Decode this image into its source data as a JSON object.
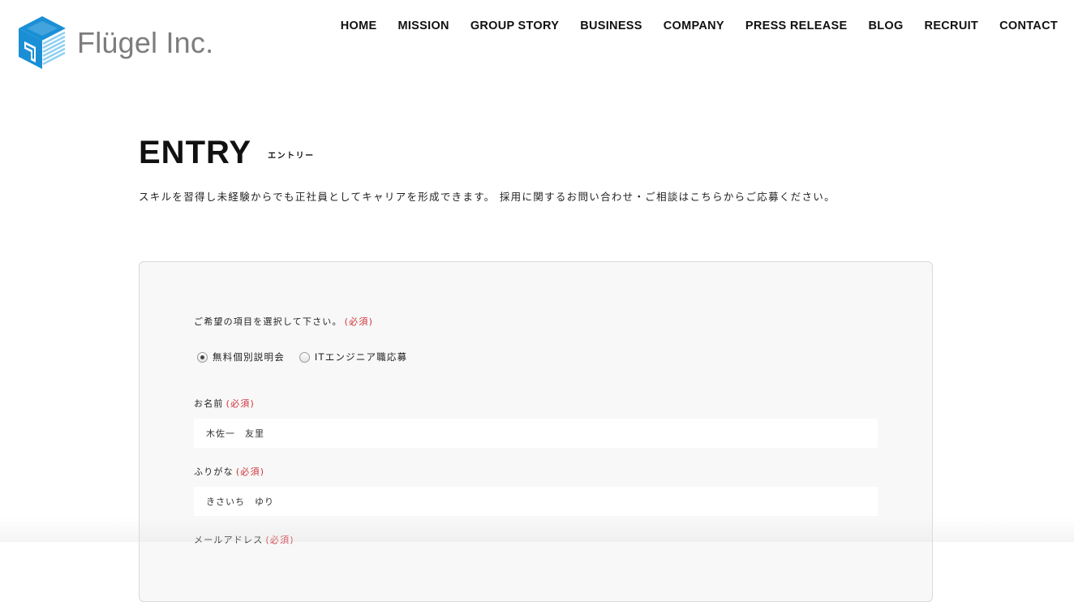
{
  "brand": {
    "name": "Flügel Inc.",
    "logo_icon": "isometric-cube-logo",
    "colors": {
      "primary": "#1a8fd6",
      "light": "#6cc3f0",
      "text": "#7d7d7d"
    }
  },
  "nav": {
    "items": [
      {
        "label": "HOME"
      },
      {
        "label": "MISSION"
      },
      {
        "label": "GROUP STORY"
      },
      {
        "label": "BUSINESS"
      },
      {
        "label": "COMPANY"
      },
      {
        "label": "PRESS RELEASE"
      },
      {
        "label": "BLOG"
      },
      {
        "label": "RECRUIT"
      },
      {
        "label": "CONTACT"
      }
    ]
  },
  "page": {
    "title": "ENTRY",
    "subtitle": "エントリー",
    "intro": "スキルを習得し未経験からでも正社員としてキャリアを形成できます。 採用に関するお問い合わせ・ご相談はこちらからご応募ください。"
  },
  "form": {
    "required_mark": "(必須)",
    "accent_color": "#d0323a",
    "choice": {
      "label": "ご希望の項目を選択して下さい。",
      "options": [
        {
          "label": "無料個別説明会",
          "selected": true
        },
        {
          "label": "ITエンジニア職応募",
          "selected": false
        }
      ]
    },
    "name": {
      "label": "お名前",
      "value": "木佐一　友里"
    },
    "furigana": {
      "label": "ふりがな",
      "value": "きさいち　ゆり"
    },
    "email": {
      "label": "メールアドレス"
    }
  }
}
